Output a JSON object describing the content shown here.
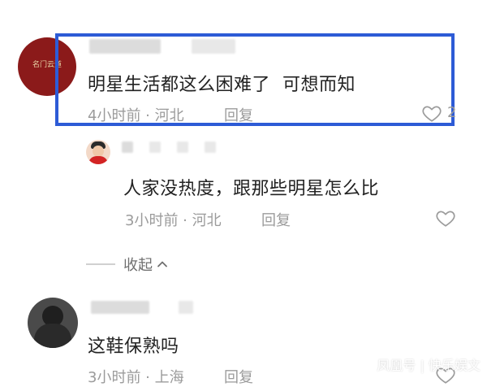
{
  "comments": [
    {
      "text": "明星生活都这么困难了  可想而知",
      "meta": "4小时前 · 河北",
      "reply_label": "回复",
      "like_count": "2",
      "avatar_text": "名门云道"
    },
    {
      "text": "人家没热度，跟那些明星怎么比",
      "meta": "3小时前 · 河北",
      "reply_label": "回复"
    },
    {
      "text": "这鞋保熟吗",
      "meta": "3小时前 · 上海",
      "reply_label": "回复"
    }
  ],
  "collapse_label": "收起",
  "watermark": "凤凰号 | 快乐娱文",
  "colors": {
    "highlight": "#2d5bd6",
    "avatar1": "#8b1a1a"
  }
}
